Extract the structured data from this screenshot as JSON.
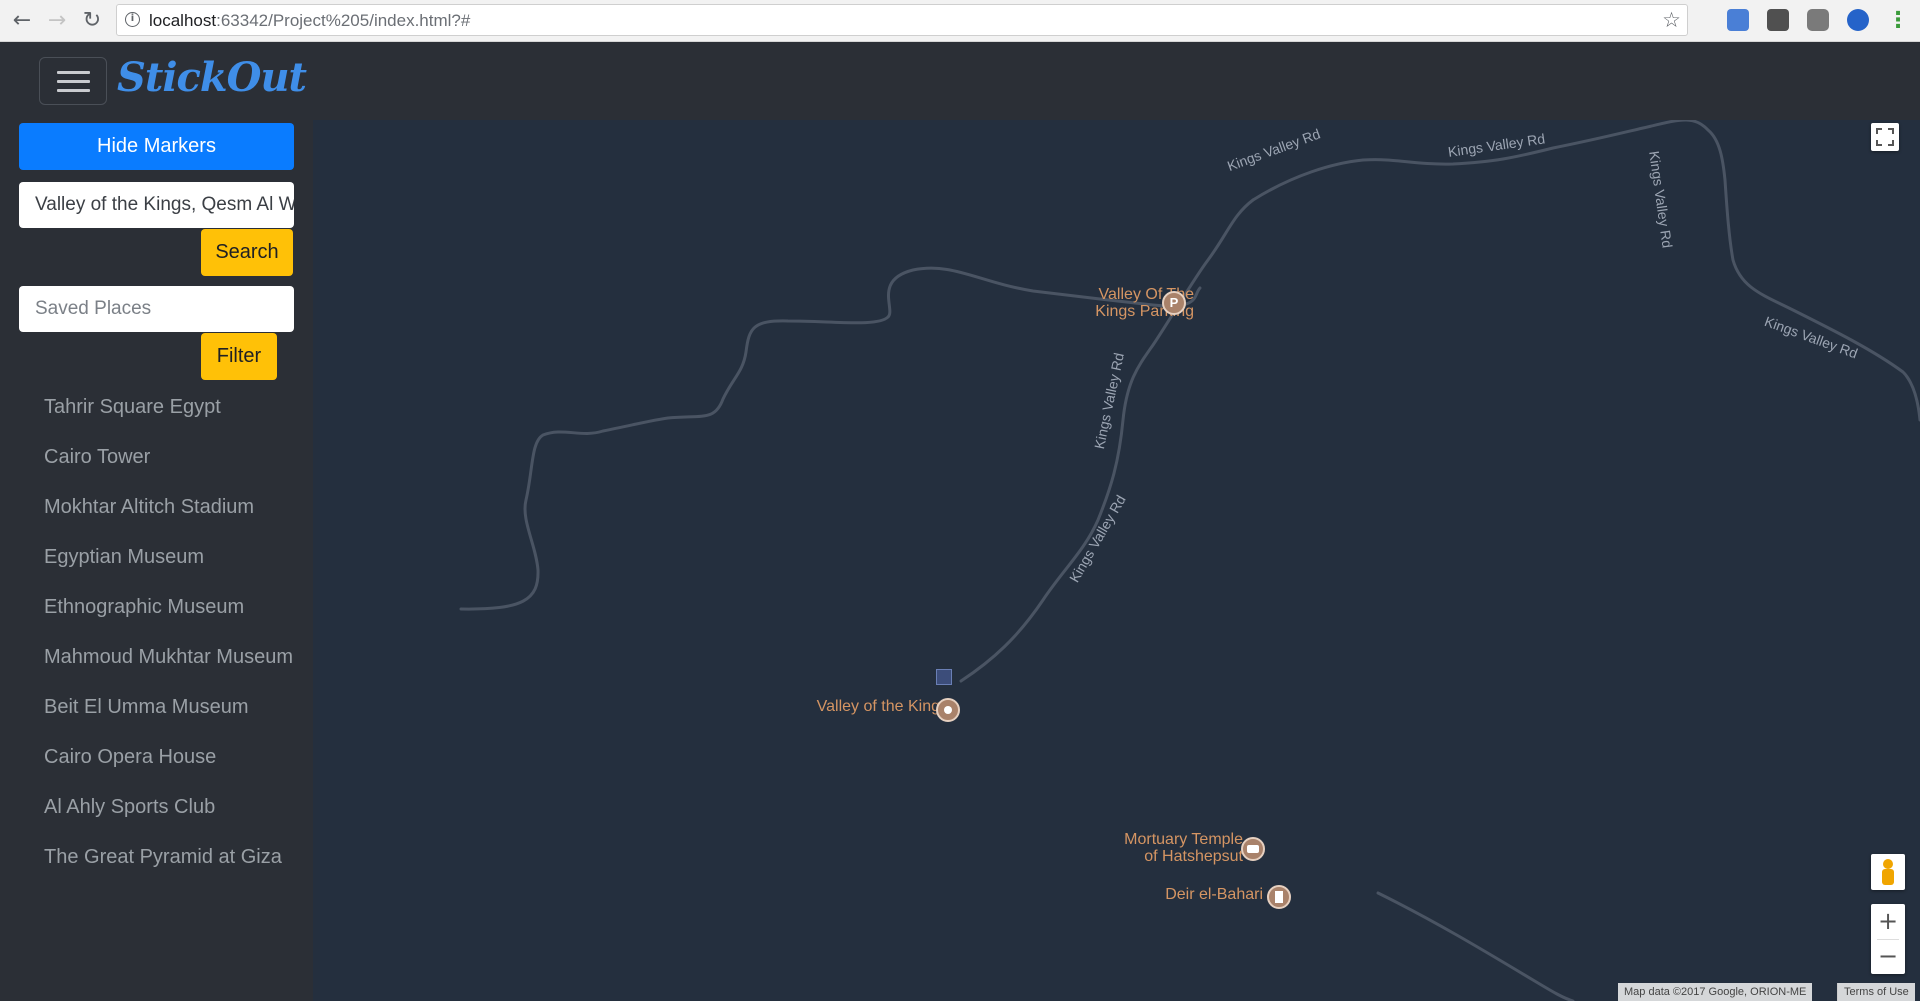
{
  "browser": {
    "url_host": "localhost",
    "url_rest": ":63342/Project%205/index.html?#"
  },
  "app": {
    "brand": "StickOut"
  },
  "sidebar": {
    "hide_markers_label": "Hide Markers",
    "search_value": "Valley of the Kings, Qesm Al Wahat Ad Dakhlah",
    "search_label": "Search",
    "saved_places_placeholder": "Saved Places",
    "filter_label": "Filter",
    "places": [
      "Tahrir Square Egypt",
      "Cairo Tower",
      "Mokhtar Altitch Stadium",
      "Egyptian Museum",
      "Ethnographic Museum",
      "Mahmoud Mukhtar Museum",
      "Beit El Umma Museum",
      "Cairo Opera House",
      "Al Ahly Sports Club",
      "The Great Pyramid at Giza"
    ]
  },
  "map": {
    "road_name": "Kings Valley Rd",
    "pois": {
      "parking_line1": "Valley Of The",
      "parking_line2": "Kings Parking",
      "parking_glyph": "P",
      "valley": "Valley of the Kings",
      "temple_line1": "Mortuary Temple",
      "temple_line2": "of Hatshepsut",
      "deir": "Deir el-Bahari"
    },
    "zoom_in": "+",
    "zoom_out": "−",
    "attribution": "Map data ©2017 Google, ORION-ME",
    "terms": "Terms of Use",
    "colors": {
      "background": "#242f3e",
      "road": "#4a5463",
      "poi_text": "#d59563",
      "road_label": "#9ca5b3"
    }
  }
}
